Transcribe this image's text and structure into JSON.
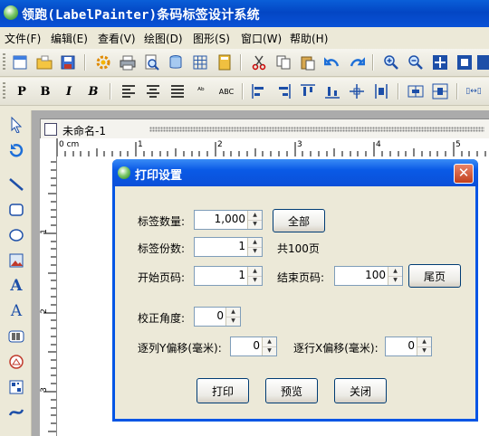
{
  "app": {
    "title": "领跑(LabelPainter)条码标签设计系统"
  },
  "menu": [
    "文件(F)",
    "编辑(E)",
    "查看(V)",
    "绘图(D)",
    "图形(S)",
    "窗口(W)",
    "帮助(H)"
  ],
  "format_toolbar": {
    "bold": "B",
    "italic": "I",
    "bold_italic": "B",
    "abc": "ABC"
  },
  "document": {
    "tab_title": "未命名-1"
  },
  "ruler": {
    "unit": "0 cm",
    "h_marks": [
      "1",
      "2",
      "3",
      "4",
      "5"
    ],
    "v_marks": [
      "1",
      "2",
      "3"
    ]
  },
  "dialog": {
    "title": "打印设置",
    "close": "✕",
    "label_count": {
      "label": "标签数量:",
      "value": "1,000"
    },
    "all_button": "全部",
    "copies": {
      "label": "标签份数:",
      "value": "1"
    },
    "total_pages": "共100页",
    "start_page": {
      "label": "开始页码:",
      "value": "1"
    },
    "end_page": {
      "label": "结束页码:",
      "value": "100"
    },
    "last_page_button": "尾页",
    "angle": {
      "label": "校正角度:",
      "value": "0"
    },
    "col_offset": {
      "label": "逐列Y偏移(毫米):",
      "value": "0"
    },
    "row_offset": {
      "label": "逐行X偏移(毫米):",
      "value": "0"
    },
    "print_button": "打印",
    "preview_button": "预览",
    "close_button": "关闭"
  },
  "colors": {
    "titlebar": "#0a52d6",
    "dialog_border": "#0055e5",
    "close_red": "#c2401c"
  }
}
